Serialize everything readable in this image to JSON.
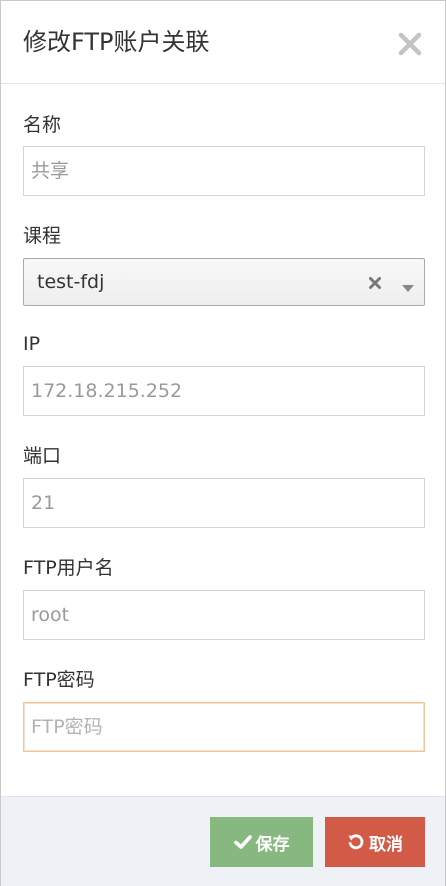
{
  "dialog": {
    "title": "修改FTP账户关联",
    "close_icon": "close-icon"
  },
  "form": {
    "name": {
      "label": "名称",
      "value": "",
      "placeholder": "共享"
    },
    "course": {
      "label": "课程",
      "selected": "test-fdj",
      "clear_icon": "clear-icon",
      "arrow_icon": "chevron-down-icon"
    },
    "ip": {
      "label": "IP",
      "value": "",
      "placeholder": "172.18.215.252"
    },
    "port": {
      "label": "端口",
      "value": "",
      "placeholder": "21"
    },
    "ftp_user": {
      "label": "FTP用户名",
      "value": "",
      "placeholder": "root"
    },
    "ftp_password": {
      "label": "FTP密码",
      "value": "",
      "placeholder": "FTP密码"
    }
  },
  "footer": {
    "save_label": "保存",
    "save_icon": "check-icon",
    "cancel_label": "取消",
    "cancel_icon": "undo-icon"
  },
  "colors": {
    "save": "#87b87f",
    "cancel": "#d15b47",
    "footer_bg": "#eef1f6",
    "focus_border": "#f0c898"
  }
}
